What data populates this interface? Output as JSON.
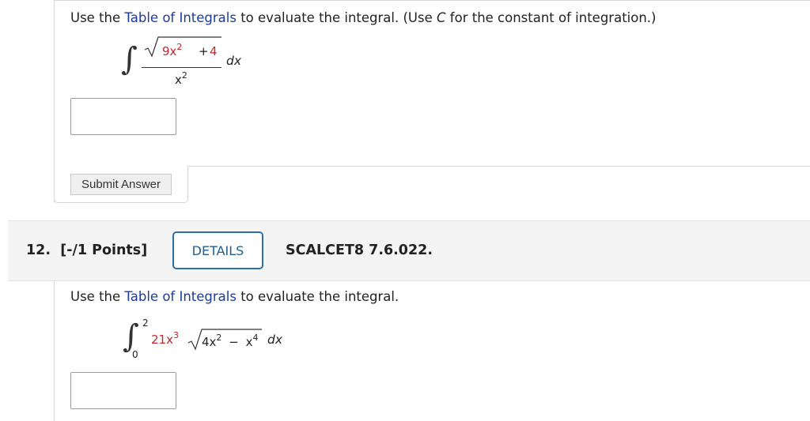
{
  "question11": {
    "prompt_before": "Use the ",
    "prompt_link": "Table of Integrals",
    "prompt_after_1": " to evaluate the integral. (Use ",
    "prompt_italic": "C",
    "prompt_after_2": " for the constant of integration.)",
    "integral_sign": "∫",
    "numerator_coef": "9x",
    "numerator_exp": "2",
    "numerator_rest": "+ 4",
    "denominator_base": "x",
    "denominator_exp": "2",
    "differential": "dx",
    "answer_value": "",
    "submit_label": "Submit Answer"
  },
  "question12": {
    "number_label": "12.",
    "points_label": "[-/1 Points]",
    "details_label": "DETAILS",
    "course_code": "SCALCET8 7.6.022.",
    "prompt_before": "Use the ",
    "prompt_link": "Table of Integrals",
    "prompt_after": " to evaluate the integral.",
    "integral_sign": "∫",
    "upper_limit": "2",
    "lower_limit": "0",
    "coef": "21x",
    "coef_exp": "3",
    "radicand_a": "4x",
    "radicand_a_exp": "2",
    "radicand_op": "−",
    "radicand_b": "x",
    "radicand_b_exp": "4",
    "differential": "dx",
    "answer_value": ""
  },
  "colors": {
    "link": "#1a3a9e",
    "highlight_red": "#c6252a",
    "details_border": "#2a6fa8"
  }
}
